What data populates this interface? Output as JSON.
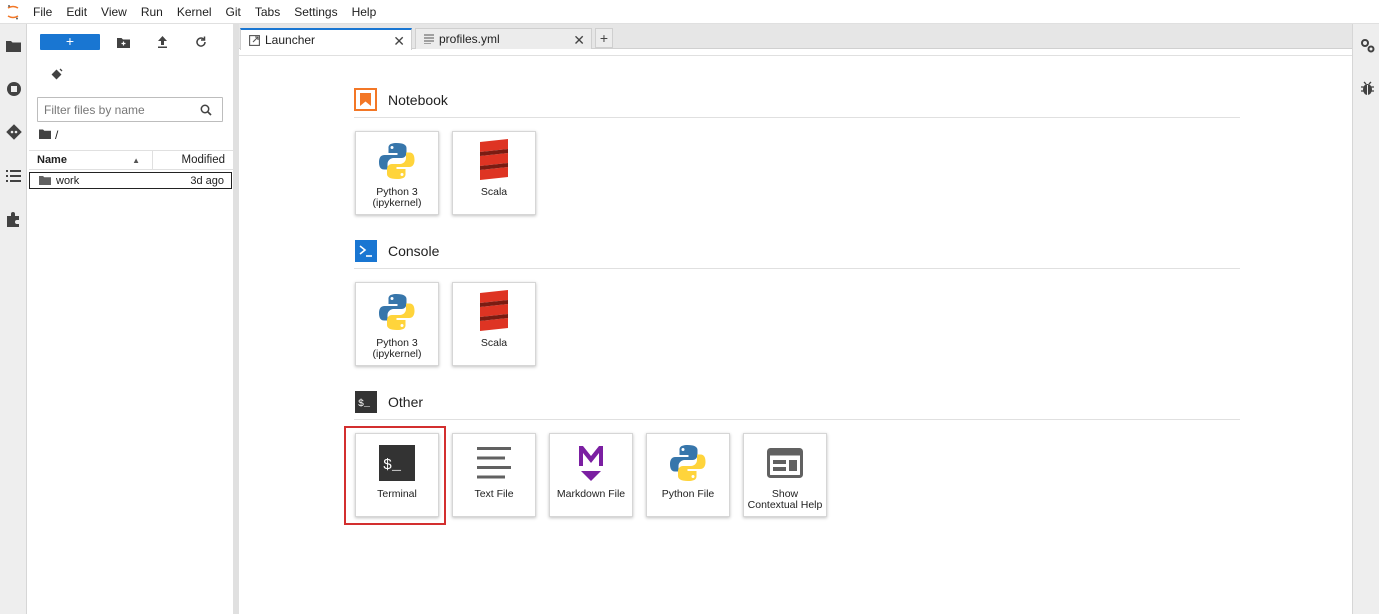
{
  "menubar": {
    "items": [
      "File",
      "Edit",
      "View",
      "Run",
      "Kernel",
      "Git",
      "Tabs",
      "Settings",
      "Help"
    ]
  },
  "filebrowser": {
    "new_label": "+",
    "filter_placeholder": "Filter files by name",
    "breadcrumb": "/",
    "columns": {
      "name": "Name",
      "modified": "Modified"
    },
    "rows": [
      {
        "name": "work",
        "modified": "3d ago"
      }
    ]
  },
  "tabs": [
    {
      "label": "Launcher",
      "close": "✕"
    },
    {
      "label": "profiles.yml",
      "close": "✕"
    }
  ],
  "tab_add": "+",
  "launcher": {
    "sections": [
      {
        "title": "Notebook",
        "cards": [
          "Python 3\n(ipykernel)",
          "Scala"
        ]
      },
      {
        "title": "Console",
        "cards": [
          "Python 3\n(ipykernel)",
          "Scala"
        ]
      },
      {
        "title": "Other",
        "cards": [
          "Terminal",
          "Text File",
          "Markdown File",
          "Python File",
          "Show\nContextual Help"
        ]
      }
    ]
  },
  "colors": {
    "accent": "#1976d2",
    "notebook_orange": "#f37726",
    "highlight": "#d32f2f",
    "scala_red": "#de3423",
    "markdown_purple": "#7b1fa2"
  }
}
